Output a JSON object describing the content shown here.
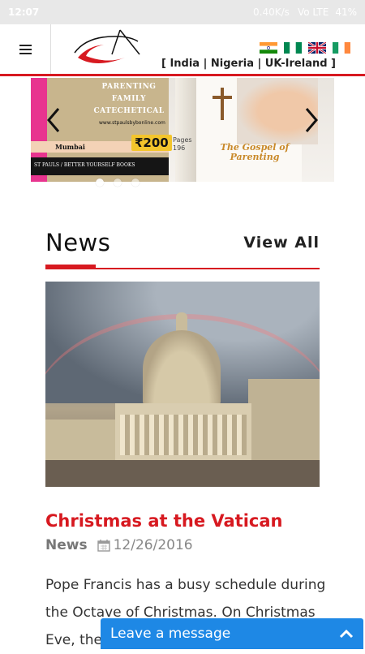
{
  "status_bar": {
    "time": "12:07",
    "speed": "0.40K/s",
    "network": "Vo LTE",
    "battery": "41%"
  },
  "header": {
    "regions": "[ India | Nigeria | UK-Ireland ]",
    "flags": [
      {
        "name": "india-flag",
        "colors": [
          "#ff9933",
          "#ffffff",
          "#138808"
        ]
      },
      {
        "name": "nigeria-flag",
        "colors": [
          "#008751",
          "#ffffff",
          "#008751"
        ]
      },
      {
        "name": "uk-flag",
        "colors": [
          "#012169",
          "#ffffff",
          "#c8102e"
        ]
      },
      {
        "name": "ireland-flag",
        "colors": [
          "#169b62",
          "#ffffff",
          "#ff883e"
        ]
      }
    ]
  },
  "carousel": {
    "headline_lines": [
      "PARENTING",
      "FAMILY",
      "CATECHETICAL"
    ],
    "site": "www.stpaulsbybonline.com",
    "city": "Mumbai",
    "publisher": "ST PAULS / BETTER YOURSELF BOOKS",
    "book_title": "The Gospel of Parenting",
    "price": "₹200",
    "pages_label": "Pages",
    "pages_value": "196",
    "dots": 3,
    "active_dot": 0
  },
  "news": {
    "section_title": "News",
    "view_all": "View All",
    "article": {
      "title": "Christmas at the Vatican",
      "category": "News",
      "date": "12/26/2016",
      "excerpt": "Pope Francis has a busy schedule during the Octave of Christmas. On Christmas Eve, the"
    }
  },
  "chat": {
    "label": "Leave a message"
  },
  "colors": {
    "accent": "#d71920",
    "chat": "#1e88e5"
  }
}
